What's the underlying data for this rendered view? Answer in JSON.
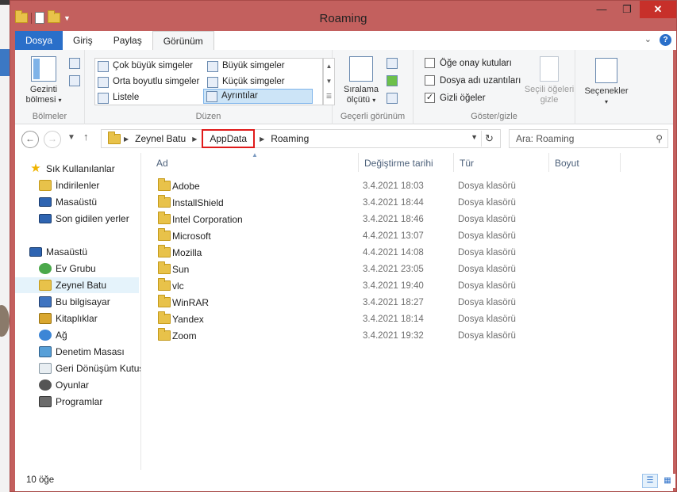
{
  "window": {
    "title": "Roaming",
    "minimize": "—",
    "maximize": "❐",
    "close": "✕"
  },
  "tabs": [
    {
      "label": "Dosya"
    },
    {
      "label": "Giriş"
    },
    {
      "label": "Paylaş"
    },
    {
      "label": "Görünüm"
    }
  ],
  "ribbon": {
    "panes": {
      "nav_pane_label1": "Gezinti",
      "nav_pane_label2": "bölmesi",
      "group_label": "Bölmeler"
    },
    "layout": {
      "group_label": "Düzen",
      "items": [
        "Çok büyük simgeler",
        "Büyük simgeler",
        "Orta boyutlu simgeler",
        "Küçük simgeler",
        "Listele",
        "Ayrıntılar"
      ],
      "selected": "Ayrıntılar"
    },
    "current_view": {
      "sort_label1": "Sıralama",
      "sort_label2": "ölçütü",
      "group_label": "Geçerli görünüm"
    },
    "show_hide": {
      "item_checkboxes": "Öğe onay kutuları",
      "file_extensions": "Dosya adı uzantıları",
      "hidden_items": "Gizli öğeler",
      "hide_selected1": "Seçili öğeleri",
      "hide_selected2": "gizle",
      "group_label": "Göster/gizle",
      "hidden_items_checked": true
    },
    "options": {
      "label": "Seçenekler"
    }
  },
  "address": {
    "crumbs": [
      "Zeynel Batu",
      "AppData",
      "Roaming"
    ],
    "highlighted": "AppData"
  },
  "search": {
    "placeholder": "Ara: Roaming"
  },
  "nav_pane": {
    "items": [
      {
        "label": "Sık Kullanılanlar",
        "icon": "star-icon"
      },
      {
        "label": "İndirilenler",
        "icon": "downloads-folder-icon"
      },
      {
        "label": "Masaüstü",
        "icon": "desktop-icon"
      },
      {
        "label": "Son gidilen yerler",
        "icon": "recent-places-icon"
      },
      {
        "label": "Masaüstü",
        "icon": "desktop-icon"
      },
      {
        "label": "Ev Grubu",
        "icon": "homegroup-icon"
      },
      {
        "label": "Zeynel Batu",
        "icon": "user-folder-icon"
      },
      {
        "label": "Bu bilgisayar",
        "icon": "computer-icon"
      },
      {
        "label": "Kitaplıklar",
        "icon": "libraries-icon"
      },
      {
        "label": "Ağ",
        "icon": "network-icon"
      },
      {
        "label": "Denetim Masası",
        "icon": "control-panel-icon"
      },
      {
        "label": "Geri Dönüşüm Kutusu",
        "icon": "recycle-bin-icon"
      },
      {
        "label": "Oyunlar",
        "icon": "games-icon"
      },
      {
        "label": "Programlar",
        "icon": "programs-icon"
      }
    ]
  },
  "columns": {
    "name": "Ad",
    "modified": "Değiştirme tarihi",
    "type": "Tür",
    "size": "Boyut"
  },
  "files": [
    {
      "name": "Adobe",
      "modified": "3.4.2021 18:03",
      "type": "Dosya klasörü"
    },
    {
      "name": "InstallShield",
      "modified": "3.4.2021 18:44",
      "type": "Dosya klasörü"
    },
    {
      "name": "Intel Corporation",
      "modified": "3.4.2021 18:46",
      "type": "Dosya klasörü"
    },
    {
      "name": "Microsoft",
      "modified": "4.4.2021 13:07",
      "type": "Dosya klasörü"
    },
    {
      "name": "Mozilla",
      "modified": "4.4.2021 14:08",
      "type": "Dosya klasörü"
    },
    {
      "name": "Sun",
      "modified": "3.4.2021 23:05",
      "type": "Dosya klasörü"
    },
    {
      "name": "vlc",
      "modified": "3.4.2021 19:40",
      "type": "Dosya klasörü"
    },
    {
      "name": "WinRAR",
      "modified": "3.4.2021 18:27",
      "type": "Dosya klasörü"
    },
    {
      "name": "Yandex",
      "modified": "3.4.2021 18:14",
      "type": "Dosya klasörü"
    },
    {
      "name": "Zoom",
      "modified": "3.4.2021 19:32",
      "type": "Dosya klasörü"
    }
  ],
  "status": {
    "count": "10 öğe"
  },
  "colors": {
    "titlebar": "#c3605e",
    "file_tab": "#2a6fc9",
    "highlight_box": "#e01b1b",
    "selection": "#cce4f7"
  }
}
